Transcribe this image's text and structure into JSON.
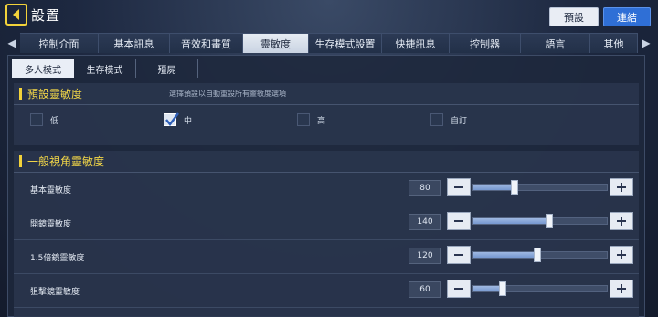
{
  "header": {
    "title": "設置",
    "preset_label": "預設",
    "link_label": "連結"
  },
  "tabs": [
    {
      "label": "控制介面",
      "active": false
    },
    {
      "label": "基本訊息",
      "active": false
    },
    {
      "label": "音效和畫質",
      "active": false
    },
    {
      "label": "靈敏度",
      "active": true
    },
    {
      "label": "生存模式設置",
      "active": false
    },
    {
      "label": "快捷訊息",
      "active": false
    },
    {
      "label": "控制器",
      "active": false
    },
    {
      "label": "語言",
      "active": false
    },
    {
      "label": "其他",
      "active": false
    }
  ],
  "subtabs": [
    {
      "label": "多人模式",
      "active": true
    },
    {
      "label": "生存模式",
      "active": false
    },
    {
      "label": "殭屍",
      "active": false
    }
  ],
  "preset_section": {
    "title": "預設靈敏度",
    "hint": "選擇預設以自動重設所有靈敏度選項",
    "options": [
      {
        "label": "低",
        "checked": false
      },
      {
        "label": "中",
        "checked": true
      },
      {
        "label": "高",
        "checked": false
      },
      {
        "label": "自訂",
        "checked": false
      }
    ]
  },
  "view_section": {
    "title": "一般視角靈敏度",
    "rows": [
      {
        "label": "基本靈敏度",
        "value": "80",
        "level": 0.31
      },
      {
        "label": "開鏡靈敏度",
        "value": "140",
        "level": 0.57
      },
      {
        "label": "1.5倍鏡靈敏度",
        "value": "120",
        "level": 0.48
      },
      {
        "label": "狙擊鏡靈敏度",
        "value": "60",
        "level": 0.22
      }
    ]
  },
  "colors": {
    "accent_yellow": "#f2d23a",
    "link_blue": "#2f6fd6"
  }
}
